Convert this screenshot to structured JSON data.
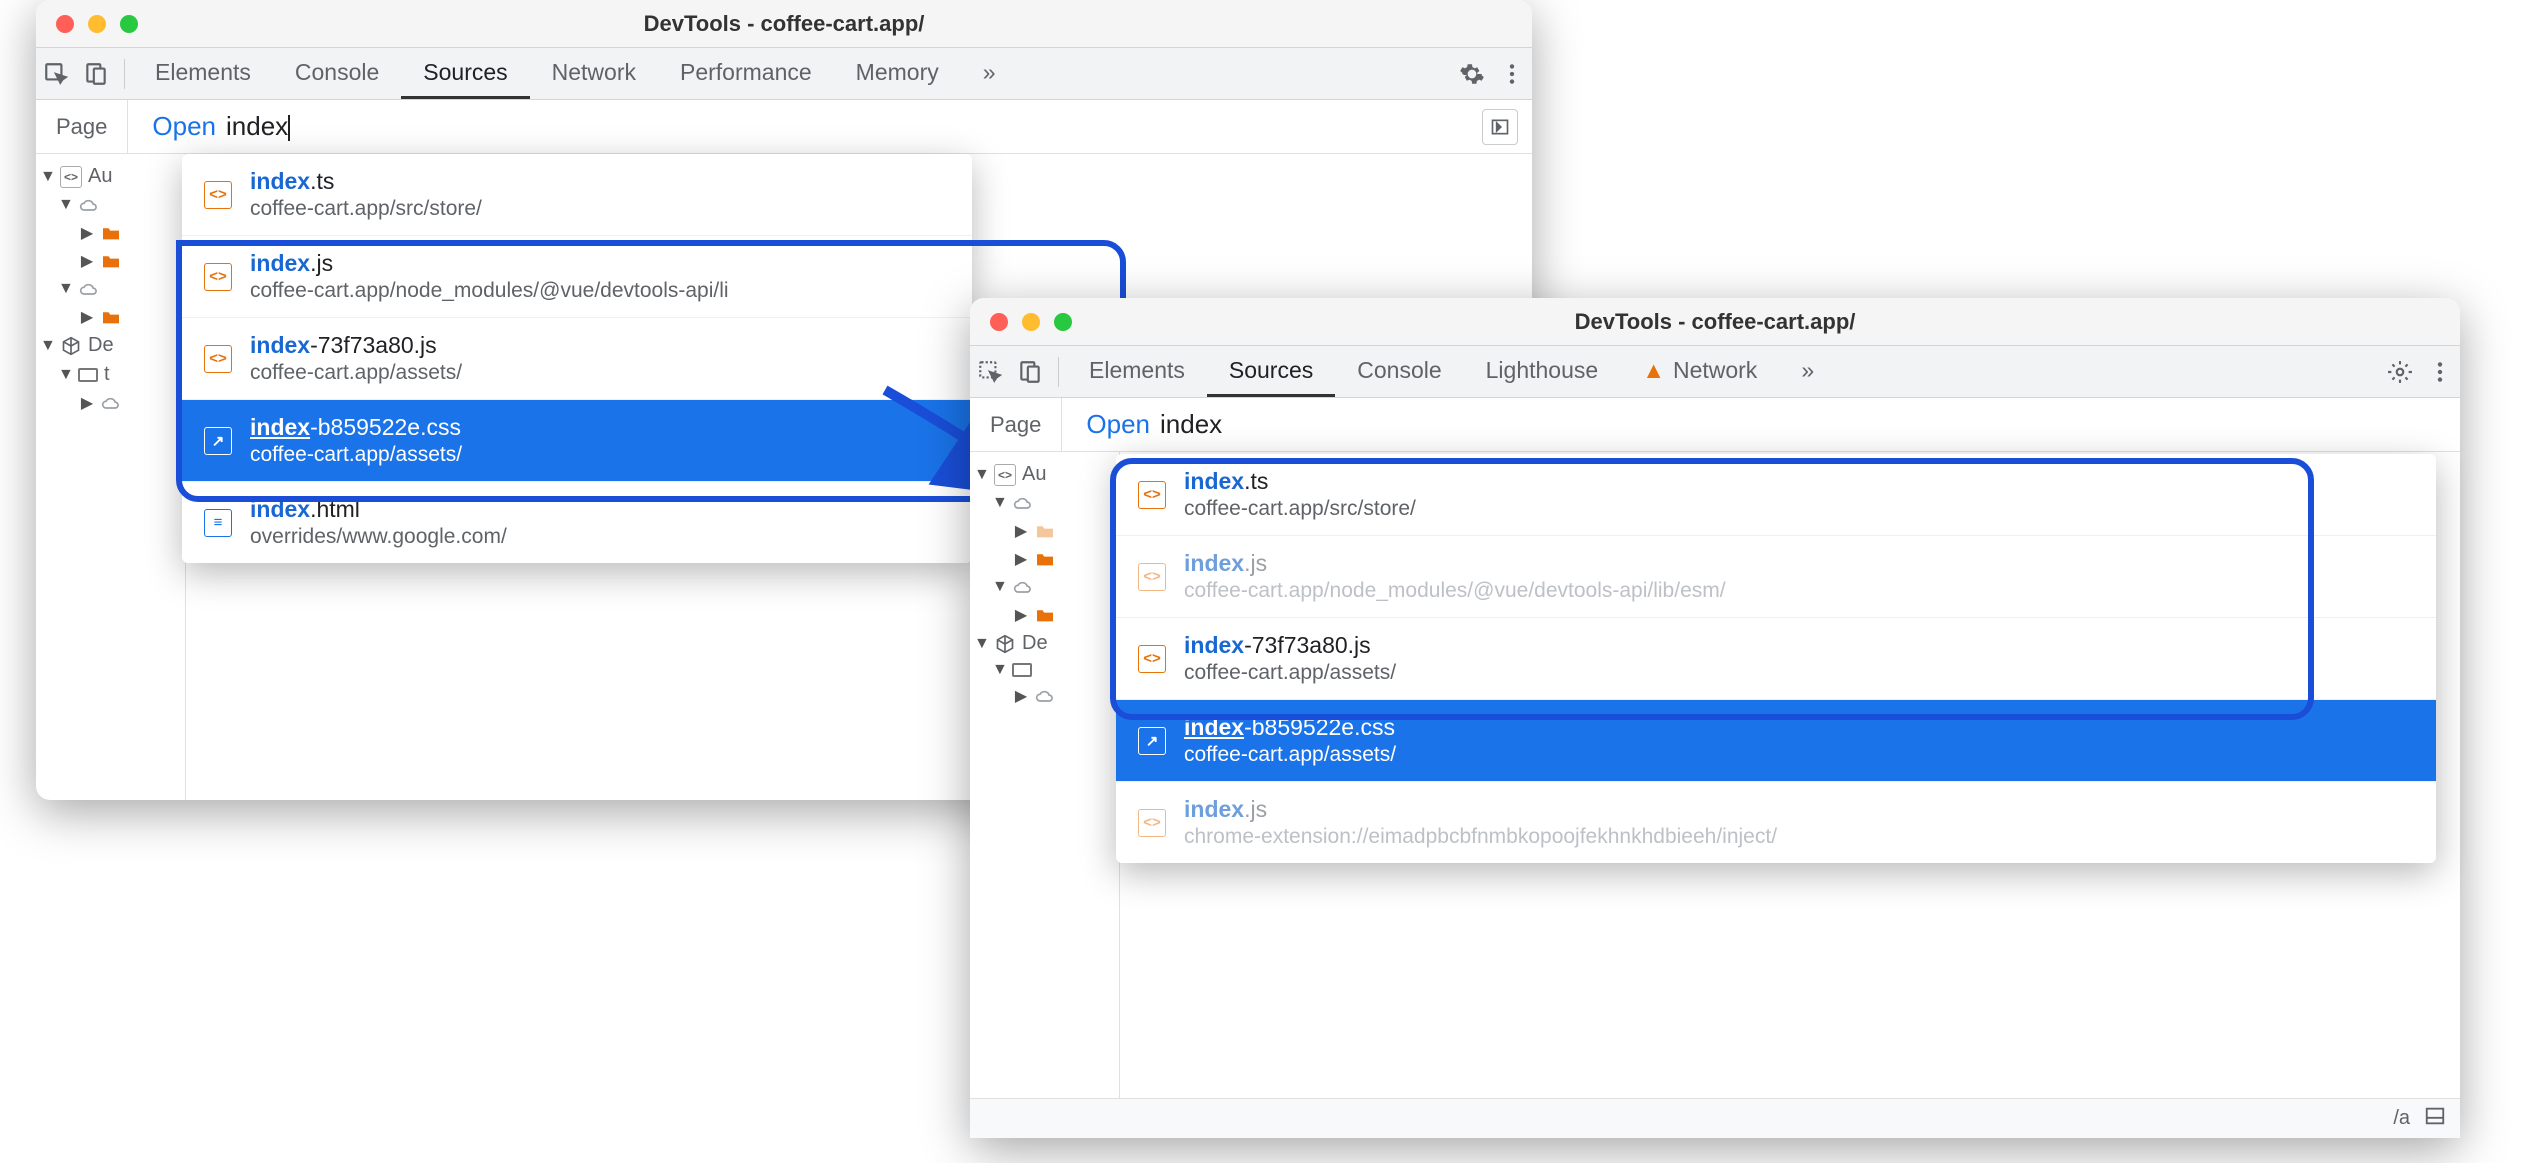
{
  "window1": {
    "title": "DevTools - coffee-cart.app/",
    "tabs": [
      "Elements",
      "Console",
      "Sources",
      "Network",
      "Performance",
      "Memory"
    ],
    "active_tab": "Sources",
    "page_label": "Page",
    "command": {
      "action": "Open",
      "query": "index"
    },
    "tree": {
      "au": "Au",
      "de": "De",
      "t": "t"
    },
    "dropdown": [
      {
        "match": "index",
        "rest": ".ts",
        "path": "coffee-cart.app/src/store/",
        "icon": "js"
      },
      {
        "match": "index",
        "rest": ".js",
        "path": "coffee-cart.app/node_modules/@vue/devtools-api/li",
        "icon": "js"
      },
      {
        "match": "index",
        "rest": "-73f73a80.js",
        "path": "coffee-cart.app/assets/",
        "icon": "js"
      },
      {
        "match": "index",
        "rest": "-b859522e.css",
        "path": "coffee-cart.app/assets/",
        "icon": "css",
        "selected": true
      },
      {
        "match": "index",
        "rest": ".html",
        "path": "overrides/www.google.com/",
        "icon": "html"
      }
    ]
  },
  "window2": {
    "title": "DevTools - coffee-cart.app/",
    "tabs": [
      "Elements",
      "Sources",
      "Console",
      "Lighthouse",
      "Network"
    ],
    "active_tab": "Sources",
    "page_label": "Page",
    "command": {
      "action": "Open",
      "query": "index"
    },
    "tree": {
      "au": "Au",
      "de": "De"
    },
    "dropdown": [
      {
        "match": "index",
        "rest": ".ts",
        "path": "coffee-cart.app/src/store/",
        "icon": "js"
      },
      {
        "match": "index",
        "rest": ".js",
        "path": "coffee-cart.app/node_modules/@vue/devtools-api/lib/esm/",
        "icon": "js",
        "dim": true
      },
      {
        "match": "index",
        "rest": "-73f73a80.js",
        "path": "coffee-cart.app/assets/",
        "icon": "js"
      },
      {
        "match": "index",
        "rest": "-b859522e.css",
        "path": "coffee-cart.app/assets/",
        "icon": "css",
        "selected": true
      },
      {
        "match": "index",
        "rest": ".js",
        "path": "chrome-extension://eimadpbcbfnmbkopoojfekhnkhdbieeh/inject/",
        "icon": "js",
        "dim": true
      }
    ],
    "bottom": "/a"
  }
}
